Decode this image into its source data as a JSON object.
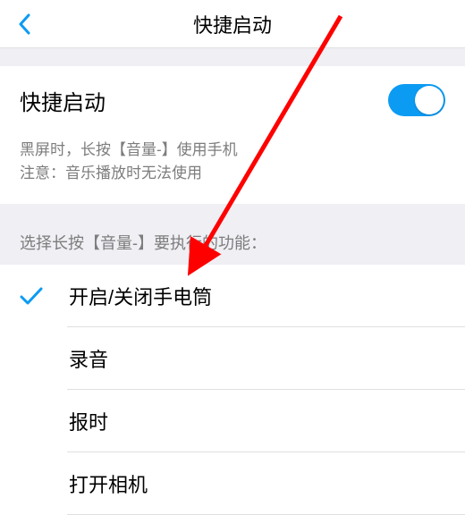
{
  "header": {
    "title": "快捷启动"
  },
  "toggle": {
    "label": "快捷启动",
    "enabled": true
  },
  "description": {
    "line1": "黑屏时，长按【音量-】使用手机",
    "line2": "注意：音乐播放时无法使用"
  },
  "section_label": "选择长按【音量-】要执行的功能：",
  "options": [
    {
      "label": "开启/关闭手电筒",
      "selected": true
    },
    {
      "label": "录音",
      "selected": false
    },
    {
      "label": "报时",
      "selected": false
    },
    {
      "label": "打开相机",
      "selected": false
    }
  ],
  "colors": {
    "accent": "#0b9bf3",
    "check": "#0b9bf3",
    "arrow": "#ff0000"
  }
}
